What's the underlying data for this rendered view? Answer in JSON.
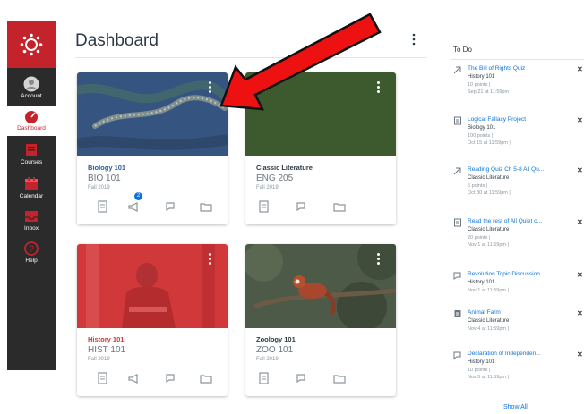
{
  "nav": {
    "brand_color": "#c4232b",
    "items": [
      {
        "label": "Account",
        "icon": "account-icon"
      },
      {
        "label": "Dashboard",
        "icon": "dashboard-icon"
      },
      {
        "label": "Courses",
        "icon": "courses-icon"
      },
      {
        "label": "Calendar",
        "icon": "calendar-icon"
      },
      {
        "label": "Inbox",
        "icon": "inbox-icon"
      },
      {
        "label": "Help",
        "icon": "help-icon"
      }
    ]
  },
  "header": {
    "title": "Dashboard"
  },
  "cards": [
    {
      "name": "Biology 101",
      "code": "BIO 101",
      "term": "Fall 2019",
      "color": "#3b5d8f",
      "name_color": "#2d5b9e",
      "badge": "2"
    },
    {
      "name": "Classic Literature",
      "code": "ENG 205",
      "term": "Fall 2019",
      "color": "#3d5a2e",
      "name_color": "#2d3b45"
    },
    {
      "name": "History 101",
      "code": "HIST 101",
      "term": "Fall 2019",
      "color": "#d0383a",
      "name_color": "#d0383a"
    },
    {
      "name": "Zoology 101",
      "code": "ZOO 101",
      "term": "Fall 2019",
      "color": "#4e5a48",
      "name_color": "#2d3b45"
    }
  ],
  "todo": {
    "title": "To Do",
    "items": [
      {
        "title": "The Bill of Rights Quiz",
        "course": "History 101",
        "points": "10 points",
        "due": "Sep 21 at 11:59pm",
        "icon": "quiz-icon"
      },
      {
        "title": "Logical Fallacy Project",
        "course": "Biology 101",
        "points": "100 points",
        "due": "Oct 15 at 11:59pm",
        "icon": "assignment-icon"
      },
      {
        "title": "Reading Quiz Ch 5-8 All Qu...",
        "course": "Classic Literature",
        "points": "5 points",
        "due": "Oct 30 at 11:59pm",
        "icon": "quiz-icon"
      },
      {
        "title": "Read the rest of All Quiet o...",
        "course": "Classic Literature",
        "points": "20 points",
        "due": "Nov 1 at 11:59pm",
        "icon": "assignment-icon"
      },
      {
        "title": "Revolution Topic Discussion",
        "course": "History 101",
        "points": "",
        "due": "Nov 1 at 11:59pm",
        "icon": "discussion-icon"
      },
      {
        "title": "Animal Farm",
        "course": "Classic Literature",
        "points": "",
        "due": "Nov 4 at 11:59pm",
        "icon": "page-icon"
      },
      {
        "title": "Declaration of Independen...",
        "course": "History 101",
        "points": "10 points",
        "due": "Nov 5 at 11:59pm",
        "icon": "discussion-icon"
      }
    ],
    "show_all": "Show All"
  }
}
